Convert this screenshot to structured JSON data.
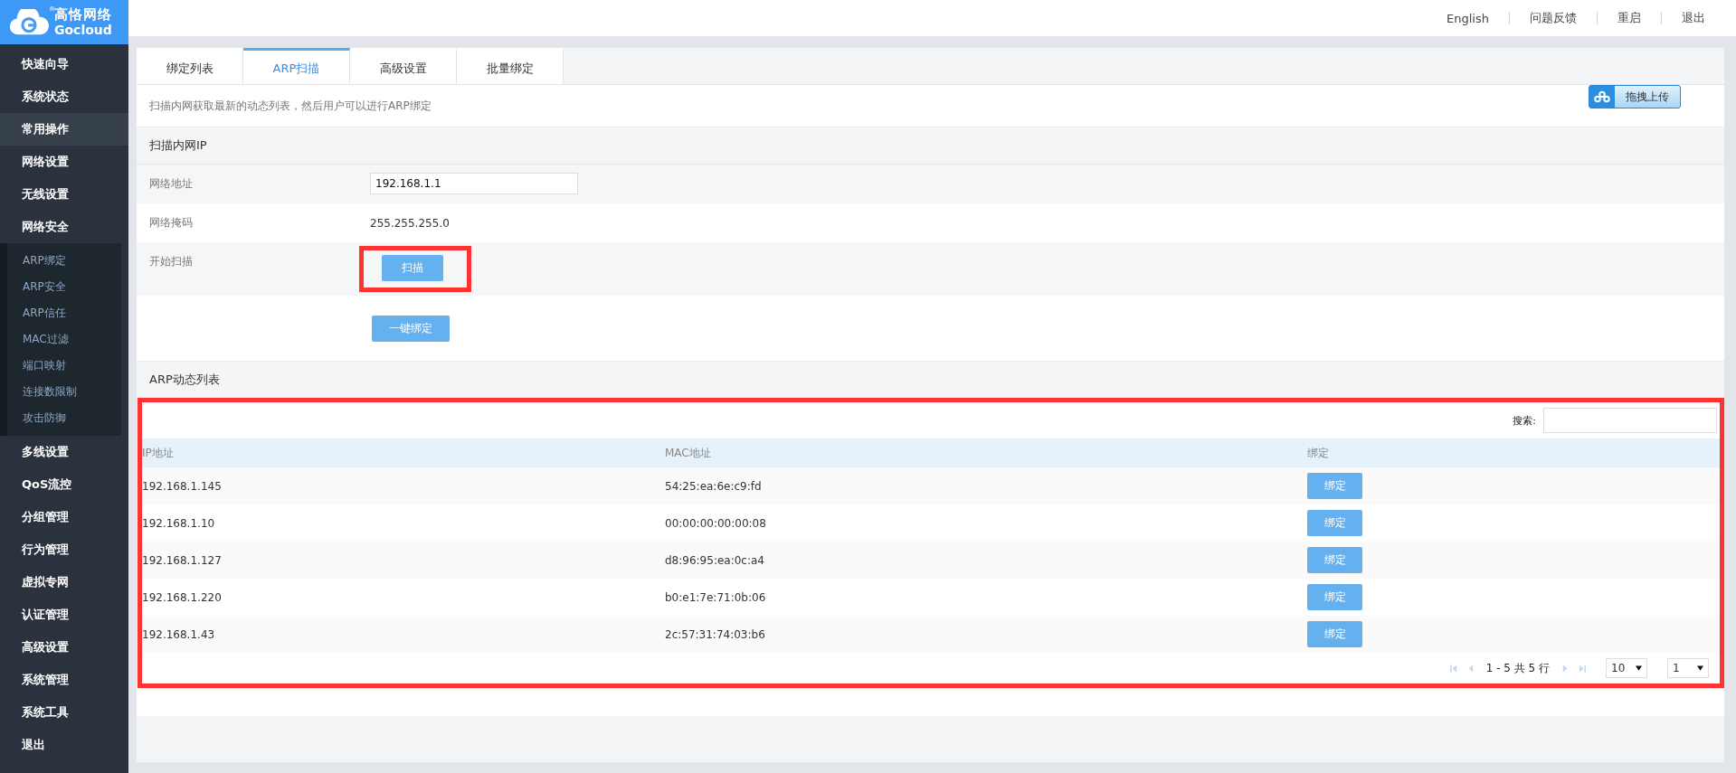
{
  "logo": {
    "name": "高恪网络",
    "brand": "Gocloud",
    "mark": "®"
  },
  "header_links": [
    {
      "label": "English"
    },
    {
      "label": "问题反馈"
    },
    {
      "label": "重启"
    },
    {
      "label": "退出"
    }
  ],
  "sidebar": {
    "items": [
      {
        "label": "快速向导",
        "selected": false
      },
      {
        "label": "系统状态",
        "selected": false
      },
      {
        "label": "常用操作",
        "selected": true
      },
      {
        "label": "网络设置",
        "selected": false
      },
      {
        "label": "无线设置",
        "selected": false
      },
      {
        "label": "网络安全",
        "selected": false,
        "expanded": true,
        "children": [
          {
            "label": "ARP绑定",
            "selected": false
          },
          {
            "label": "ARP安全",
            "selected": false
          },
          {
            "label": "ARP信任",
            "selected": false
          },
          {
            "label": "MAC过滤",
            "selected": false
          },
          {
            "label": "端口映射",
            "selected": false
          },
          {
            "label": "连接数限制",
            "selected": false
          },
          {
            "label": "攻击防御",
            "selected": false
          }
        ]
      },
      {
        "label": "多线设置",
        "selected": false
      },
      {
        "label": "QoS流控",
        "selected": false
      },
      {
        "label": "分组管理",
        "selected": false
      },
      {
        "label": "行为管理",
        "selected": false
      },
      {
        "label": "虚拟专网",
        "selected": false
      },
      {
        "label": "认证管理",
        "selected": false
      },
      {
        "label": "高级设置",
        "selected": false
      },
      {
        "label": "系统管理",
        "selected": false
      },
      {
        "label": "系统工具",
        "selected": false
      },
      {
        "label": "退出",
        "selected": false
      }
    ]
  },
  "tabs": [
    {
      "label": "绑定列表",
      "selected": false
    },
    {
      "label": "ARP扫描",
      "selected": true
    },
    {
      "label": "高级设置",
      "selected": false
    },
    {
      "label": "批量绑定",
      "selected": false
    }
  ],
  "description": "扫描内网获取最新的动态列表，然后用户可以进行ARP绑定",
  "upload_button": {
    "label": "拖拽上传"
  },
  "scan_section": {
    "title": "扫描内网IP",
    "rows": [
      {
        "kind": "input",
        "label": "网络地址",
        "value": "192.168.1.1"
      },
      {
        "kind": "text",
        "label": "网络掩码",
        "value": "255.255.255.0"
      },
      {
        "kind": "button",
        "label": "开始扫描",
        "button": "扫描",
        "highlighted": true
      },
      {
        "kind": "button",
        "button": "一键绑定",
        "highlighted": false
      }
    ]
  },
  "arp_section": {
    "title": "ARP动态列表",
    "highlighted": true,
    "search": {
      "label": "搜索:"
    },
    "table": {
      "columns": [
        "IP地址",
        "MAC地址",
        "绑定"
      ],
      "rows": [
        {
          "ip": "192.168.1.145",
          "mac": "54:25:ea:6e:c9:fd",
          "action": "绑定"
        },
        {
          "ip": "192.168.1.10",
          "mac": "00:00:00:00:00:08",
          "action": "绑定"
        },
        {
          "ip": "192.168.1.127",
          "mac": "d8:96:95:ea:0c:a4",
          "action": "绑定"
        },
        {
          "ip": "192.168.1.220",
          "mac": "b0:e1:7e:71:0b:06",
          "action": "绑定"
        },
        {
          "ip": "192.168.1.43",
          "mac": "2c:57:31:74:03:b6",
          "action": "绑定"
        }
      ]
    },
    "pagination": {
      "summary": "1 - 5 共 5 行",
      "page_size": "10",
      "page": "1"
    }
  }
}
